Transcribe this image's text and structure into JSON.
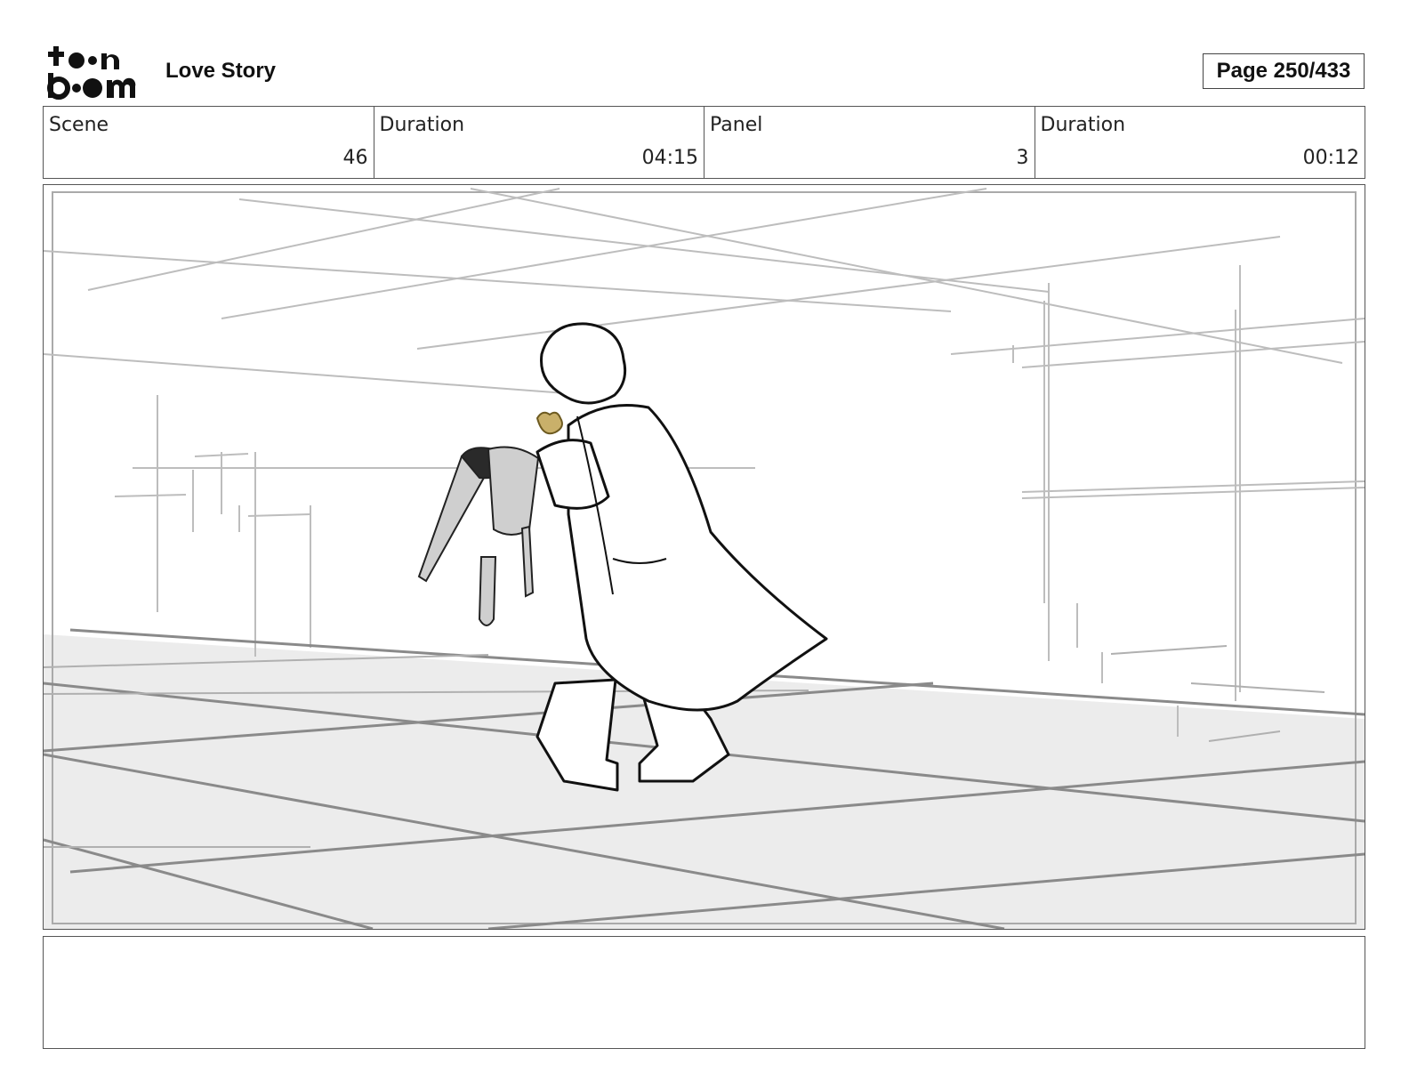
{
  "logo": {
    "alt": "toon boom",
    "icon": "toon-boom-logo"
  },
  "project_title": "Love Story",
  "page_label": "Page 250/433",
  "info": [
    {
      "label": "Scene",
      "value": "46"
    },
    {
      "label": "Duration",
      "value": "04:15"
    },
    {
      "label": "Panel",
      "value": "3"
    },
    {
      "label": "Duration",
      "value": "00:12"
    }
  ],
  "panel": {
    "description_icon": "storyboard-sketch"
  },
  "notes": ""
}
